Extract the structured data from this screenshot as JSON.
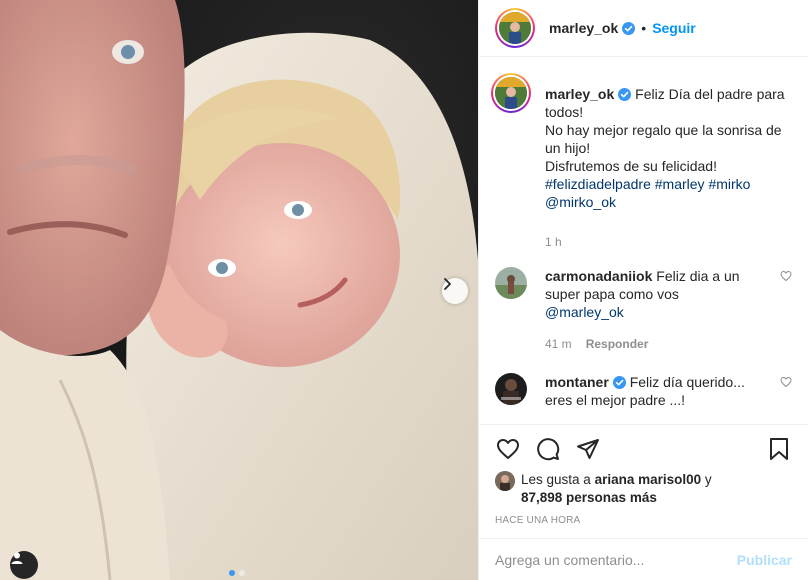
{
  "post": {
    "username": "marley_ok",
    "follow_label": "Seguir",
    "header_separator": "•"
  },
  "caption": {
    "username": "marley_ok",
    "lines": [
      "Feliz Día del padre para todos!",
      "No hay mejor regalo que la sonrisa de un hijo!",
      "Disfrutemos de su felicidad!"
    ],
    "hashtags": [
      "#felizdiadelpadre",
      "#marley",
      "#mirko"
    ],
    "mention": "@mirko_ok",
    "time": "1 h"
  },
  "comments": [
    {
      "username": "carmonadaniiok",
      "text": "Feliz dia a un super papa como vos",
      "mention": "@marley_ok",
      "time": "41 m",
      "reply_label": "Responder"
    },
    {
      "username": "montaner",
      "text": "Feliz día querido... eres el mejor padre ...!"
    }
  ],
  "likes": {
    "prefix": "Les gusta a",
    "user": "ariana marisol00",
    "conjunction": "y",
    "count": "87,898 personas más"
  },
  "post_time": "HACE UNA HORA",
  "add_comment": {
    "placeholder": "Agrega un comentario...",
    "publish_label": "Publicar"
  },
  "carousel": {
    "total": 2,
    "active": 1
  },
  "icons": {
    "like": "heart-icon",
    "comment": "comment-icon",
    "share": "paper-plane-icon",
    "save": "bookmark-icon",
    "next": "chevron-right-icon",
    "tag": "user-tag-icon"
  },
  "colors": {
    "link": "#0095f6",
    "hashtag": "#00376b",
    "muted": "#8e8e8e",
    "publish_disabled": "#b2dffc",
    "carousel_active": "#3897f0"
  }
}
